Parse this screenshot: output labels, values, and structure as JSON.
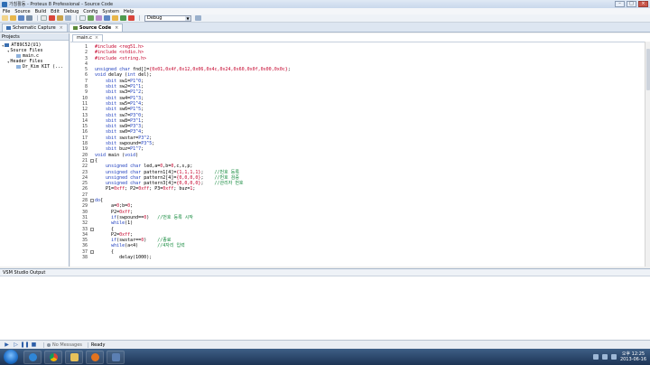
{
  "window": {
    "title": "가칭활동 - Proteus 8 Professional - Source Code"
  },
  "menu": [
    "File",
    "Source",
    "Build",
    "Edit",
    "Debug",
    "Config",
    "System",
    "Help"
  ],
  "toolbar": {
    "build_config": "Debug"
  },
  "tabs": [
    {
      "label": "Schematic Capture",
      "active": false
    },
    {
      "label": "Source Code",
      "active": true
    }
  ],
  "projects": {
    "header": "Projects",
    "tree": [
      {
        "label": "AT89C52(U1)",
        "indent": 0
      },
      {
        "label": "Source Files",
        "indent": 1
      },
      {
        "label": "main.c",
        "indent": 2
      },
      {
        "label": "Header Files",
        "indent": 1
      },
      {
        "label": "Dr_Kim KIT (...",
        "indent": 2
      }
    ]
  },
  "editor": {
    "file_tab": "main.c",
    "lines": [
      {
        "n": "1",
        "t": "#include <reg51.h>"
      },
      {
        "n": "2",
        "t": "#include <stdio.h>"
      },
      {
        "n": "3",
        "t": "#include <string.h>"
      },
      {
        "n": "4",
        "t": ""
      },
      {
        "n": "5",
        "t": "unsigned char fnd[]={0x01,0x4f,0x12,0x06,0x4c,0x24,0x60,0x0f,0x00,0x0c};"
      },
      {
        "n": "6",
        "t": "void delay (int del);"
      },
      {
        "n": "7",
        "t": "    sbit sw1=P1^0;"
      },
      {
        "n": "8",
        "t": "    sbit sw2=P1^1;"
      },
      {
        "n": "9",
        "t": "    sbit sw3=P1^2;"
      },
      {
        "n": "10",
        "t": "    sbit sw4=P1^3;"
      },
      {
        "n": "11",
        "t": "    sbit sw5=P1^4;"
      },
      {
        "n": "12",
        "t": "    sbit sw6=P1^5;"
      },
      {
        "n": "13",
        "t": "    sbit sw7=P3^0;"
      },
      {
        "n": "14",
        "t": "    sbit sw8=P3^1;"
      },
      {
        "n": "15",
        "t": "    sbit sw9=P3^3;"
      },
      {
        "n": "16",
        "t": "    sbit sw0=P3^4;"
      },
      {
        "n": "17",
        "t": "    sbit swstar=P3^2;"
      },
      {
        "n": "18",
        "t": "    sbit swpound=P3^5;"
      },
      {
        "n": "19",
        "t": "    sbit buz=P1^7;"
      },
      {
        "n": "20",
        "t": "void main (void)"
      },
      {
        "n": "21",
        "t": "{",
        "fold": true
      },
      {
        "n": "22",
        "t": "    unsigned char led,a=0,b=0,c,s,p;"
      },
      {
        "n": "23",
        "t": "    unsigned char pattern1[4]={1,1,1,1};    //번호 등록"
      },
      {
        "n": "24",
        "t": "    unsigned char pattern2[4]={0,0,0,0};    //번호 검증"
      },
      {
        "n": "25",
        "t": "    unsigned char pattern3[4]={0,0,0,0};    //관리자 번호"
      },
      {
        "n": "26",
        "t": "    P1=0xff; P2=0xff; P3=0xff; buz=1;"
      },
      {
        "n": "27",
        "t": ""
      },
      {
        "n": "28",
        "t": "do{",
        "fold": true
      },
      {
        "n": "29",
        "t": "      a=0;b=0;"
      },
      {
        "n": "30",
        "t": "      P2=0xff;"
      },
      {
        "n": "31",
        "t": "      if(swpound==0)   //번호 등록 시작"
      },
      {
        "n": "32",
        "t": "      while(1)"
      },
      {
        "n": "33",
        "t": "      {",
        "fold": true
      },
      {
        "n": "34",
        "t": "      P2=0xff;"
      },
      {
        "n": "35",
        "t": "      if(swstar==0)    //종료"
      },
      {
        "n": "36",
        "t": "      while(a<4)       //4자리 입력"
      },
      {
        "n": "37",
        "t": "      {",
        "fold": true
      },
      {
        "n": "38",
        "t": "         delay(1000);"
      }
    ]
  },
  "output": {
    "header": "VSM Studio Output"
  },
  "statusbar": {
    "messages": "No Messages",
    "state": "Ready"
  },
  "taskbar": {
    "time": "오후 12:25",
    "date": "2013-06-16"
  }
}
